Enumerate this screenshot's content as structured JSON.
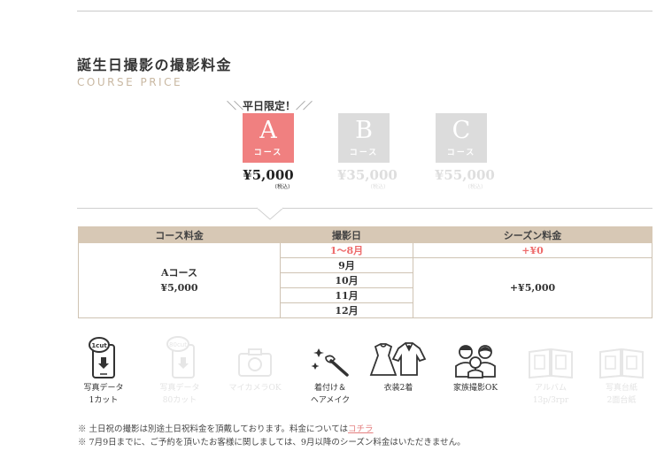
{
  "section": {
    "title": "誕生日撮影の撮影料金",
    "subtitle": "COURSE PRICE",
    "badge": "平日限定！",
    "badge_left": "＼＼",
    "badge_right": "／／"
  },
  "courses": [
    {
      "letter": "A",
      "kana": "コース",
      "price": "¥5,000",
      "tax": "(税込)",
      "active": true
    },
    {
      "letter": "B",
      "kana": "コース",
      "price": "¥35,000",
      "tax": "(税込)",
      "active": false
    },
    {
      "letter": "C",
      "kana": "コース",
      "price": "¥55,000",
      "tax": "(税込)",
      "active": false
    }
  ],
  "table": {
    "headers": [
      "コース料金",
      "撮影日",
      "シーズン料金"
    ],
    "course_name": "Aコース",
    "course_price": "¥5,000",
    "months": [
      "1〜8月",
      "9月",
      "10月",
      "11月",
      "12月"
    ],
    "season_free": "+¥0",
    "season_fee": "+¥5,000"
  },
  "features": [
    {
      "label": "写真データ\n1カット",
      "icon": "phone-1cut-icon",
      "active": true
    },
    {
      "label": "写真データ\n80カット",
      "icon": "phone-80cut-icon",
      "active": false
    },
    {
      "label": "マイカメラOK",
      "icon": "camera-icon",
      "active": false
    },
    {
      "label": "着付け＆\nヘアメイク",
      "icon": "makeup-brush-icon",
      "active": true
    },
    {
      "label": "衣装2着",
      "icon": "costume-icon",
      "active": true
    },
    {
      "label": "家族撮影OK",
      "icon": "family-icon",
      "active": true
    },
    {
      "label": "アルバム\n13p/3rpr",
      "icon": "album-icon",
      "active": false
    },
    {
      "label": "写真台紙\n2面台紙",
      "icon": "photo-mount-icon",
      "active": false
    }
  ],
  "phone_badge_1": "1cut",
  "phone_badge_80": "80cut",
  "notes": {
    "line1_prefix": "※ 土日祝の撮影は別途土日祝料金を頂戴しております。料金については",
    "line1_link": "コチラ",
    "line2": "※ 7月9日までに、ご予約を頂いたお客様に関しましては、9月以降のシーズン料金はいただきません。"
  },
  "colors": {
    "accent": "#f08080",
    "table_header": "#d7c8b5",
    "subtitle": "#c9b8a2",
    "inactive": "#dcdcdc"
  }
}
